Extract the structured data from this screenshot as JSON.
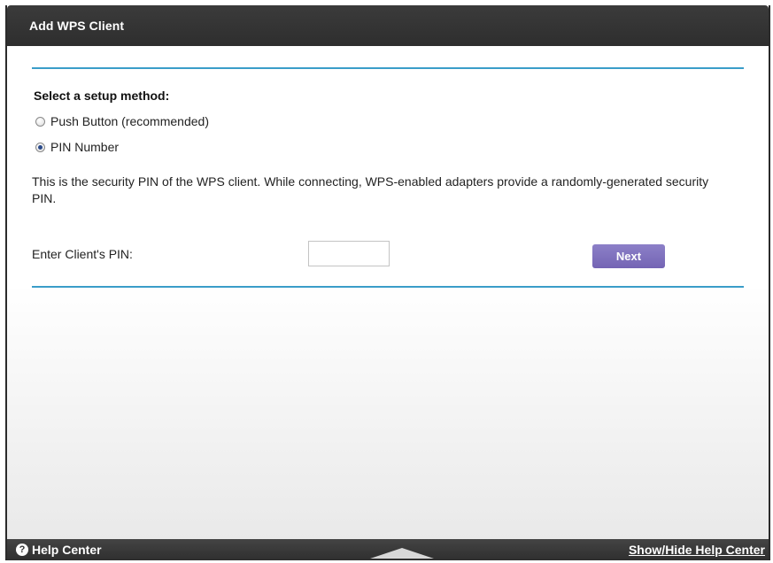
{
  "window": {
    "title": "Add WPS Client"
  },
  "setup": {
    "heading": "Select a setup method:",
    "options": [
      {
        "label": "Push Button (recommended)",
        "selected": false
      },
      {
        "label": "PIN Number",
        "selected": true
      }
    ]
  },
  "description": "This is the security PIN of the WPS client. While connecting, WPS-enabled adapters provide a randomly-generated security PIN.",
  "pin": {
    "label": "Enter Client's PIN:",
    "value": "",
    "placeholder": ""
  },
  "buttons": {
    "next": "Next"
  },
  "footer": {
    "help_center": "Help Center",
    "help_icon_glyph": "?",
    "show_hide": "Show/Hide Help Center"
  },
  "colors": {
    "accent_rule": "#3a9dc9",
    "next_button": "#7a6cbc",
    "titlebar": "#333333"
  },
  "icons": {
    "help": "help-circle-icon",
    "toggle": "triangle-up-icon"
  }
}
